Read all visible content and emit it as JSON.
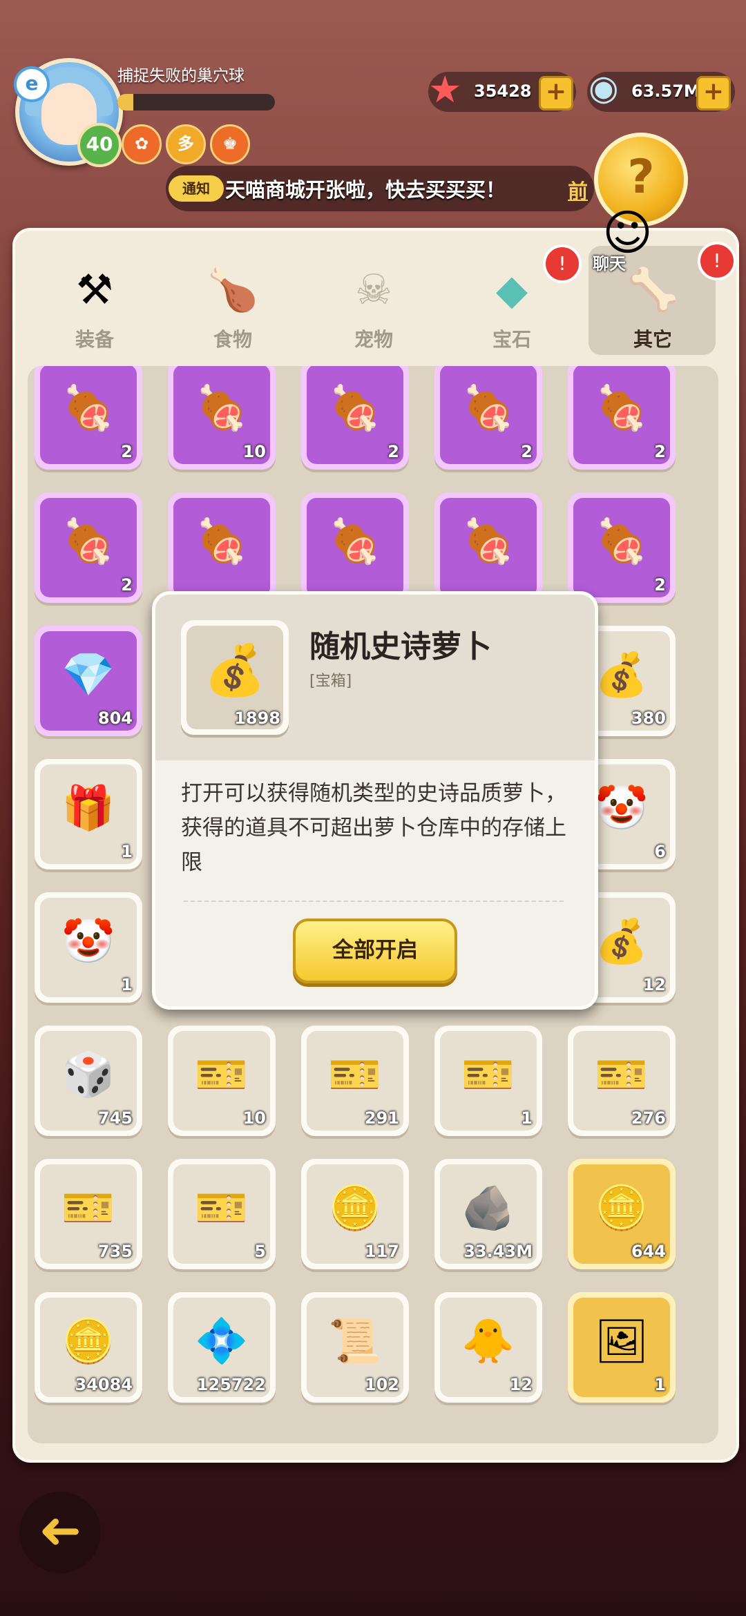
{
  "header": {
    "quest_title": "捕捉失败的巢穴球",
    "exp_progress": 0.1,
    "level": "40",
    "avatar_badge": "e",
    "buffs": [
      {
        "glyph": "✿",
        "color": "#ee6a2a"
      },
      {
        "glyph": "多",
        "color": "#f1a928"
      },
      {
        "glyph": "♚",
        "color": "#ec6c28"
      }
    ]
  },
  "resources": {
    "starfish": {
      "icon": "starfish-icon",
      "glyph": "★",
      "value": "35428"
    },
    "shell": {
      "icon": "shell-icon",
      "glyph": "◉",
      "value": "63.57M"
    },
    "plus_glyph": "+"
  },
  "notice": {
    "tag": "通知",
    "text": "天喵商城开张啦，快去买买买！",
    "link": "前",
    "coin_glyph": "?"
  },
  "chat": {
    "label": "聊天",
    "glyph": "☺"
  },
  "tabs": [
    {
      "label": "装备",
      "glyph": "⚒"
    },
    {
      "label": "食物",
      "glyph": "🍗"
    },
    {
      "label": "宠物",
      "glyph": "☠"
    },
    {
      "label": "宝石",
      "glyph": "◆"
    },
    {
      "label": "其它",
      "glyph": "🦴"
    }
  ],
  "bell_glyph": "!",
  "grid": {
    "rows": [
      [
        {
          "g": "🍖",
          "c": "2",
          "s": "purple"
        },
        {
          "g": "🍖",
          "c": "10",
          "s": "purple"
        },
        {
          "g": "🍖",
          "c": "2",
          "s": "purple"
        },
        {
          "g": "🍖",
          "c": "2",
          "s": "purple"
        },
        {
          "g": "🍖",
          "c": "2",
          "s": "purple"
        }
      ],
      [
        {
          "g": "🍖",
          "c": "2",
          "s": "purple"
        },
        {
          "g": "🍖",
          "c": "",
          "s": "purple"
        },
        {
          "g": "🍖",
          "c": "",
          "s": "purple"
        },
        {
          "g": "🍖",
          "c": "",
          "s": "purple"
        },
        {
          "g": "🍖",
          "c": "2",
          "s": "purple"
        }
      ],
      [
        {
          "g": "💎",
          "c": "804",
          "s": "purple"
        },
        {
          "g": "",
          "c": "",
          "s": "normal"
        },
        {
          "g": "",
          "c": "",
          "s": "normal"
        },
        {
          "g": "",
          "c": "",
          "s": "normal"
        },
        {
          "g": "💰",
          "c": "380",
          "s": "normal"
        }
      ],
      [
        {
          "g": "🎁",
          "c": "1",
          "s": "normal"
        },
        {
          "g": "",
          "c": "",
          "s": "normal"
        },
        {
          "g": "",
          "c": "",
          "s": "normal"
        },
        {
          "g": "",
          "c": "",
          "s": "normal"
        },
        {
          "g": "🤡",
          "c": "6",
          "s": "normal"
        }
      ],
      [
        {
          "g": "🤡",
          "c": "1",
          "s": "normal"
        },
        {
          "g": "",
          "c": "",
          "s": "normal"
        },
        {
          "g": "",
          "c": "",
          "s": "normal"
        },
        {
          "g": "",
          "c": "",
          "s": "normal"
        },
        {
          "g": "💰",
          "c": "12",
          "s": "normal"
        }
      ],
      [
        {
          "g": "🎲",
          "c": "745",
          "s": "normal"
        },
        {
          "g": "🎫",
          "c": "10",
          "s": "normal"
        },
        {
          "g": "🎫",
          "c": "291",
          "s": "normal"
        },
        {
          "g": "🎫",
          "c": "1",
          "s": "normal"
        },
        {
          "g": "🎫",
          "c": "276",
          "s": "normal"
        }
      ],
      [
        {
          "g": "🎫",
          "c": "735",
          "s": "normal"
        },
        {
          "g": "🎫",
          "c": "5",
          "s": "normal"
        },
        {
          "g": "🪙",
          "c": "117",
          "s": "normal"
        },
        {
          "g": "🪨",
          "c": "33.43M",
          "s": "normal"
        },
        {
          "g": "🪙",
          "c": "644",
          "s": "gold"
        }
      ],
      [
        {
          "g": "🪙",
          "c": "34084",
          "s": "normal"
        },
        {
          "g": "💠",
          "c": "125722",
          "s": "normal"
        },
        {
          "g": "📜",
          "c": "102",
          "s": "normal"
        },
        {
          "g": "🐥",
          "c": "12",
          "s": "normal"
        },
        {
          "g": "🖼",
          "c": "1",
          "s": "gold"
        }
      ]
    ]
  },
  "popup": {
    "title": "随机史诗萝卜",
    "type": "[宝箱]",
    "count": "1898",
    "glyph": "💰",
    "description": "打开可以获得随机类型的史诗品质萝卜，获得的道具不可超出萝卜仓库中的存储上限",
    "button": "全部开启"
  },
  "back_glyph": "➜"
}
